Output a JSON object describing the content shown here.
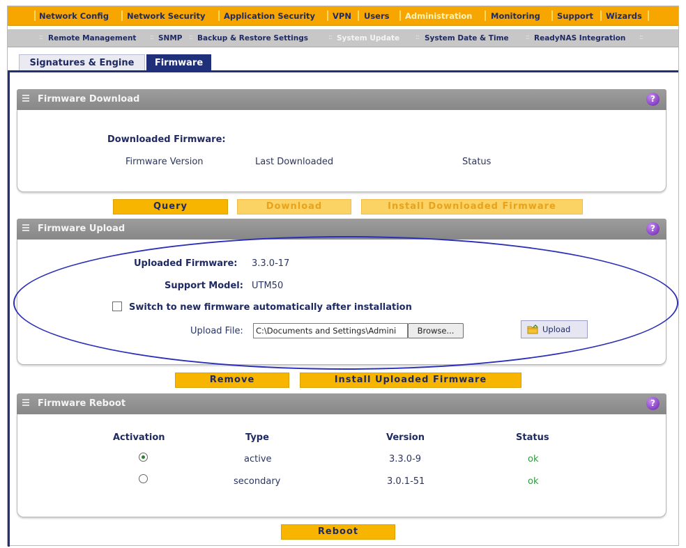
{
  "top_nav": {
    "items": [
      {
        "label": "Network Config",
        "active": false
      },
      {
        "label": "Network Security",
        "active": false
      },
      {
        "label": "Application Security",
        "active": false
      },
      {
        "label": "VPN",
        "active": false
      },
      {
        "label": "Users",
        "active": false
      },
      {
        "label": "Administration",
        "active": true
      },
      {
        "label": "Monitoring",
        "active": false
      },
      {
        "label": "Support",
        "active": false
      },
      {
        "label": "Wizards",
        "active": false
      }
    ]
  },
  "sub_nav": {
    "items": [
      {
        "label": "Remote Management",
        "active": false
      },
      {
        "label": "SNMP",
        "active": false
      },
      {
        "label": "Backup & Restore Settings",
        "active": false
      },
      {
        "label": "System Update",
        "active": true
      },
      {
        "label": "System Date & Time",
        "active": false
      },
      {
        "label": "ReadyNAS Integration",
        "active": false
      }
    ]
  },
  "tabs": [
    {
      "label": "Signatures & Engine",
      "active": false
    },
    {
      "label": "Firmware",
      "active": true
    }
  ],
  "firmware_download": {
    "title": "Firmware Download",
    "downloaded_label": "Downloaded Firmware:",
    "columns": [
      "Firmware Version",
      "Last Downloaded",
      "Status"
    ],
    "buttons": {
      "query": "Query",
      "download": "Download",
      "install": "Install Downloaded Firmware"
    }
  },
  "firmware_upload": {
    "title": "Firmware Upload",
    "uploaded_label": "Uploaded Firmware:",
    "uploaded_value": "3.3.0-17",
    "model_label": "Support Model:",
    "model_value": "UTM50",
    "switch_label": "Switch to new firmware automatically after installation",
    "switch_checked": false,
    "file_label": "Upload File:",
    "file_value": "C:\\Documents and Settings\\Admini",
    "browse": "Browse...",
    "upload": "Upload",
    "buttons": {
      "remove": "Remove",
      "install": "Install Uploaded Firmware"
    }
  },
  "firmware_reboot": {
    "title": "Firmware Reboot",
    "headers": {
      "activation": "Activation",
      "type": "Type",
      "version": "Version",
      "status": "Status"
    },
    "rows": [
      {
        "selected": true,
        "type": "active",
        "version": "3.3.0-9",
        "status": "ok"
      },
      {
        "selected": false,
        "type": "secondary",
        "version": "3.0.1-51",
        "status": "ok"
      }
    ],
    "reboot": "Reboot"
  },
  "help_icon": "?",
  "colors": {
    "nav_orange": "#f7a600",
    "nav_text": "#1f2a63",
    "tab_active": "#1f2f7a",
    "button_yellow": "#f7b500",
    "status_ok": "#2e9a3a",
    "annotation_ellipse": "#2a2fb8"
  }
}
